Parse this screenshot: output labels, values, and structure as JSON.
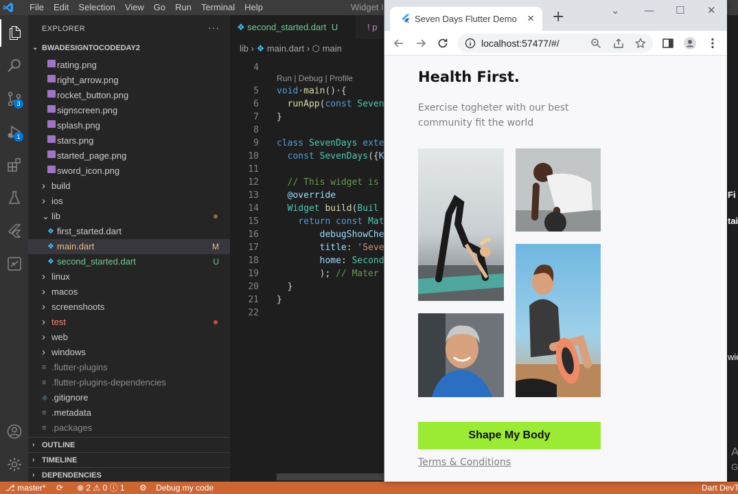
{
  "vscode": {
    "menu": [
      "File",
      "Edit",
      "Selection",
      "View",
      "Go",
      "Run",
      "Terminal",
      "Help"
    ],
    "window_title": "Widget In",
    "activity_badges": {
      "source_control": "3",
      "run_debug": "1"
    },
    "sidebar": {
      "header": "EXPLORER",
      "more": "···",
      "project": "BWADESIGNTOCODEDAY2",
      "files": [
        {
          "name": "rating.png",
          "kind": "image",
          "indent": 2
        },
        {
          "name": "right_arrow.png",
          "kind": "image",
          "indent": 2
        },
        {
          "name": "rocket_button.png",
          "kind": "image",
          "indent": 2
        },
        {
          "name": "signscreen.png",
          "kind": "image",
          "indent": 2
        },
        {
          "name": "splash.png",
          "kind": "image",
          "indent": 2
        },
        {
          "name": "stars.png",
          "kind": "image",
          "indent": 2
        },
        {
          "name": "started_page.png",
          "kind": "image",
          "indent": 2
        },
        {
          "name": "sword_icon.png",
          "kind": "image",
          "indent": 2
        },
        {
          "name": "build",
          "kind": "folder",
          "indent": 1
        },
        {
          "name": "ios",
          "kind": "folder",
          "indent": 1
        },
        {
          "name": "lib",
          "kind": "folder-open",
          "indent": 1,
          "dot": "#8c6e4e"
        },
        {
          "name": "first_started.dart",
          "kind": "dart",
          "indent": 2
        },
        {
          "name": "main.dart",
          "kind": "dart",
          "indent": 2,
          "status": "M",
          "status_color": "#e2c08d",
          "name_color": "#e2c08d",
          "selected": true
        },
        {
          "name": "second_started.dart",
          "kind": "dart",
          "indent": 2,
          "status": "U",
          "status_color": "#73c991",
          "name_color": "#73c991"
        },
        {
          "name": "linux",
          "kind": "folder",
          "indent": 1
        },
        {
          "name": "macos",
          "kind": "folder",
          "indent": 1
        },
        {
          "name": "screenshoots",
          "kind": "folder",
          "indent": 1
        },
        {
          "name": "test",
          "kind": "folder",
          "indent": 1,
          "name_color": "#f48771",
          "dot": "#c74e39"
        },
        {
          "name": "web",
          "kind": "folder",
          "indent": 1
        },
        {
          "name": "windows",
          "kind": "folder",
          "indent": 1
        },
        {
          "name": ".flutter-plugins",
          "kind": "text",
          "indent": 1,
          "name_color": "#8b8b8b"
        },
        {
          "name": ".flutter-plugins-dependencies",
          "kind": "text",
          "indent": 1,
          "name_color": "#8b8b8b"
        },
        {
          "name": ".gitignore",
          "kind": "git",
          "indent": 1
        },
        {
          "name": ".metadata",
          "kind": "text",
          "indent": 1
        },
        {
          "name": ".packages",
          "kind": "text",
          "indent": 1,
          "name_color": "#8b8b8b"
        }
      ],
      "panels": [
        "OUTLINE",
        "TIMELINE",
        "DEPENDENCIES"
      ]
    },
    "editor": {
      "tab_active": "second_started.dart",
      "tab_active_status": "U",
      "tab_next": "p",
      "breadcrumb": {
        "folder": "lib",
        "file": "main.dart",
        "symbol": "main"
      },
      "codelens": "Run | Debug | Profile",
      "lines": [
        {
          "n": "4",
          "html": ""
        },
        {
          "n": "5",
          "html": "<span class='kw'>void</span>·<span class='fn'>main</span>()·{"
        },
        {
          "n": "6",
          "html": "  <span class='fn'>runApp</span>(<span class='kw'>const</span> <span class='ty'>Seven</span>"
        },
        {
          "n": "7",
          "html": "}"
        },
        {
          "n": "8",
          "html": ""
        },
        {
          "n": "9",
          "html": "<span class='kw'>class</span> <span class='ty'>SevenDays</span> <span class='kw'>exte</span>"
        },
        {
          "n": "10",
          "html": "  <span class='kw'>const</span> <span class='ty'>SevenDays</span>({<span class='an'>K</span>"
        },
        {
          "n": "11",
          "html": ""
        },
        {
          "n": "12",
          "html": "  <span class='cm'>// This widget is</span>"
        },
        {
          "n": "13",
          "html": "  <span class='an'>@override</span>"
        },
        {
          "n": "14",
          "html": "  <span class='ty'>Widget</span> <span class='fn'>build</span>(<span class='ty'>Buil</span>"
        },
        {
          "n": "15",
          "html": "    <span class='kw'>return</span> <span class='kw'>const</span> <span class='ty'>Mat</span>"
        },
        {
          "n": "16",
          "html": "        <span class='an'>debugShowChe</span>"
        },
        {
          "n": "17",
          "html": "        <span class='an'>title</span>: <span class='str'>'Seve</span>"
        },
        {
          "n": "18",
          "html": "        <span class='an'>home</span>: <span class='ty'>Second</span>"
        },
        {
          "n": "19",
          "html": "        ); <span class='cm'>// Mater</span>"
        },
        {
          "n": "20",
          "html": "  }"
        },
        {
          "n": "21",
          "html": "}"
        },
        {
          "n": "22",
          "html": ""
        }
      ]
    },
    "status": {
      "branch": "master*",
      "errors": "2",
      "warnings": "0",
      "info": "1",
      "debug": "Debug my code",
      "right": "Dart DevT"
    },
    "right_strip": [
      "Fi",
      "tai",
      "wid",
      "A",
      "G"
    ]
  },
  "browser": {
    "tab_title": "Seven Days Flutter Demo",
    "url": "localhost:57477/#/",
    "page": {
      "title": "Health First.",
      "subtitle": "Exercise togheter with our best community fit the world",
      "cta": "Shape My Body",
      "terms": "Terms & Conditions"
    }
  },
  "colors": {
    "accent_green": "#9bea34",
    "status_bar": "#cc6633",
    "vscode_blue": "#0078d4"
  }
}
